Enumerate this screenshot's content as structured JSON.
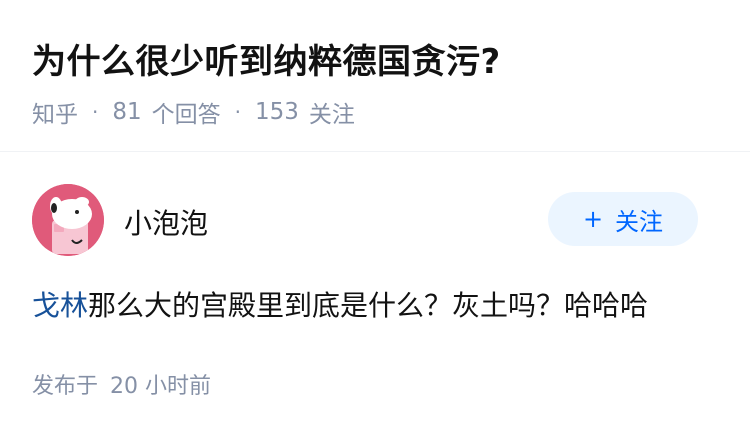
{
  "question": {
    "title": "为什么很少听到纳粹德国贪污?",
    "source": "知乎",
    "answers_count": "81",
    "answers_label": "个回答",
    "followers_count": "153",
    "followers_label": "关注"
  },
  "answer": {
    "author": {
      "name": "小泡泡",
      "avatar_icon": "cartoon-dog-avatar-icon"
    },
    "follow_button": {
      "plus_icon": "plus-icon",
      "label": "关注"
    },
    "content": {
      "link_text": "戈林",
      "text": "那么大的宫殿里到底是什么？灰土吗？哈哈哈"
    },
    "time": {
      "prefix": "发布于",
      "value": "20 小时前"
    }
  },
  "colors": {
    "title": "#121212",
    "meta": "#8590a6",
    "link": "#175199",
    "follow_bg": "#ebf5ff",
    "follow_text": "#0066ff",
    "avatar_bg": "#e05a7a"
  }
}
